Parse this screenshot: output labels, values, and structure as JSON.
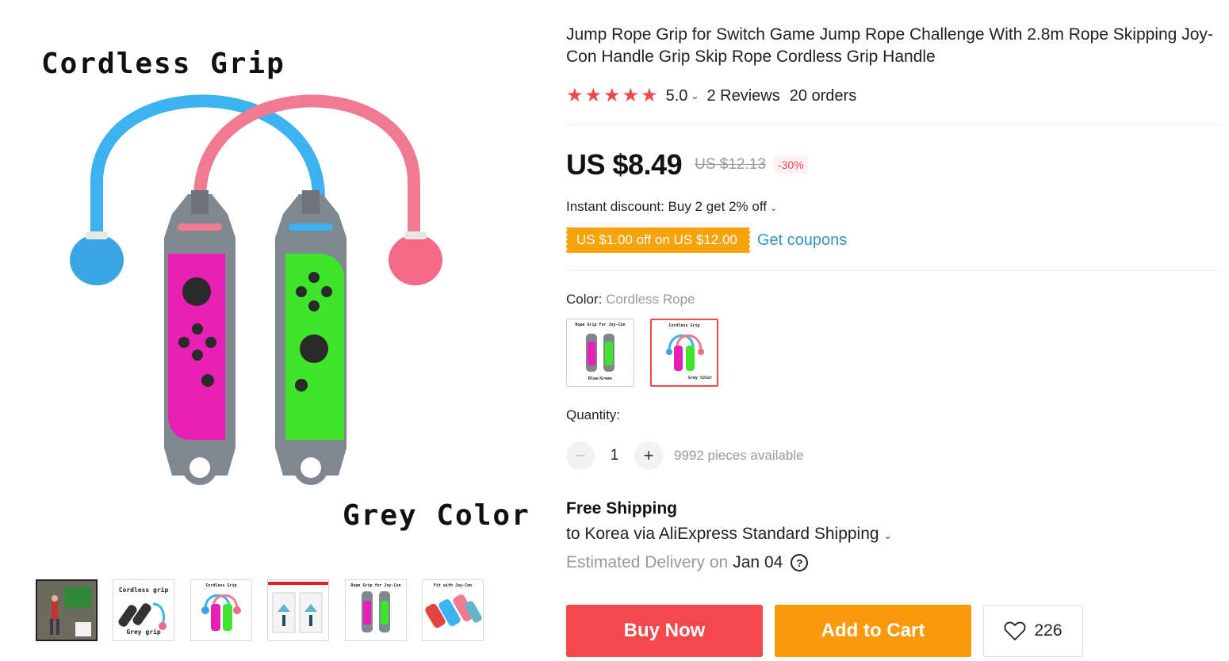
{
  "gallery": {
    "main_image": {
      "top_text": "Cordless Grip",
      "bottom_text": "Grey Color"
    },
    "thumbnails": [
      {
        "name": "thumb-1",
        "caption_top": "",
        "caption_bottom": ""
      },
      {
        "name": "thumb-2",
        "caption_top": "Cordless grip",
        "caption_bottom": "Grey grip"
      },
      {
        "name": "thumb-3",
        "caption_top": "Cordless Grip",
        "caption_bottom": ""
      },
      {
        "name": "thumb-4",
        "caption_top": "",
        "caption_bottom": ""
      },
      {
        "name": "thumb-5",
        "caption_top": "Rope Grip for Joy-Con",
        "caption_bottom": ""
      },
      {
        "name": "thumb-6",
        "caption_top": "Fit with Joy-Con",
        "caption_bottom": ""
      }
    ]
  },
  "product": {
    "title": "Jump Rope Grip for Switch Game Jump Rope Challenge With 2.8m Rope Skipping Joy-Con Handle Grip Skip Rope Cordless Grip Handle",
    "rating": "5.0",
    "stars": 5,
    "reviews": "2 Reviews",
    "orders": "20 orders"
  },
  "price": {
    "current": "US $8.49",
    "original": "US $12.13",
    "discount": "-30%",
    "instant_discount": "Instant discount: Buy 2 get 2% off",
    "coupon": "US $1.00 off on US $12.00",
    "get_coupons": "Get coupons"
  },
  "variant": {
    "label": "Color:",
    "selected": "Cordless Rope",
    "swatches": [
      {
        "caption_top": "Rope Grip For Joy-Con",
        "caption_bottom": "Blue/Green"
      },
      {
        "caption_top": "Cordless Grip",
        "caption_bottom": "Grey Color"
      }
    ]
  },
  "quantity": {
    "label": "Quantity:",
    "minus": "−",
    "plus": "+",
    "value": "1",
    "stock": "9992 pieces available"
  },
  "shipping": {
    "title": "Free Shipping",
    "destination": "to Korea via AliExpress Standard Shipping",
    "estimated_label": "Estimated Delivery on",
    "estimated_date": "Jan 04"
  },
  "actions": {
    "buy_now": "Buy Now",
    "add_to_cart": "Add to Cart",
    "wishlist_count": "226"
  },
  "colors": {
    "accent_red": "#f3484c",
    "accent_orange": "#fa9a0b",
    "link_blue": "#3593c8",
    "joycon_pink": "#e81fb4",
    "joycon_green": "#3ee52a",
    "rope_blue": "#3cb3ef",
    "rope_pink": "#f07a92"
  }
}
